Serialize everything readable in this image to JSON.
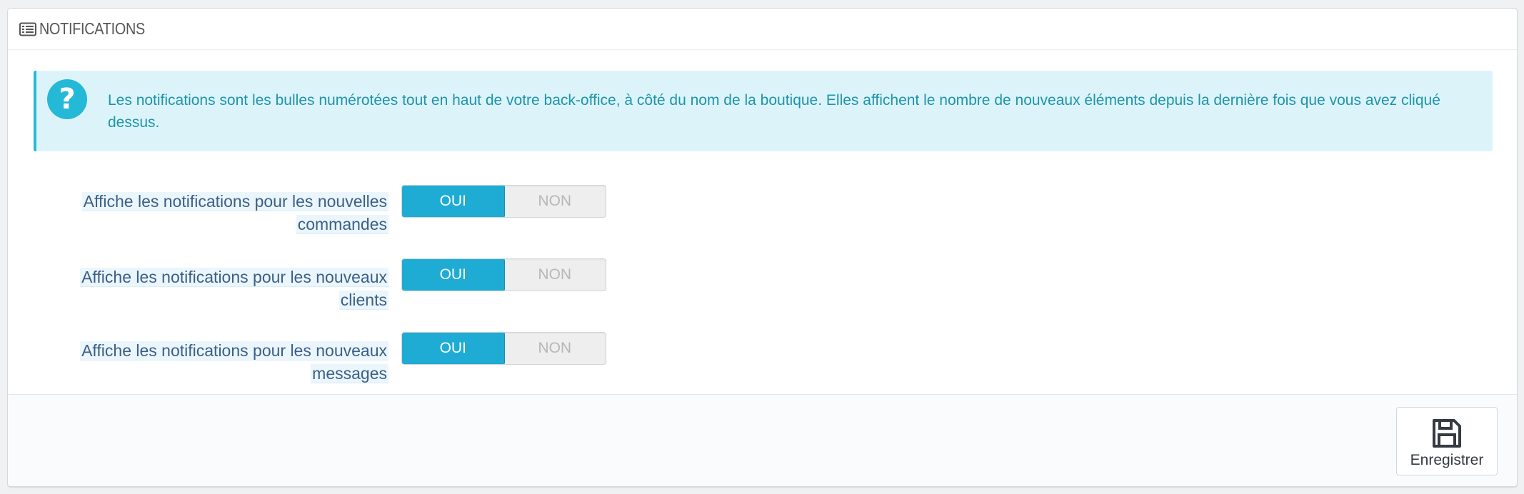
{
  "panel": {
    "title": "NOTIFICATIONS",
    "icon": "list-icon"
  },
  "alert": {
    "icon": "question-circle-icon",
    "text": "Les notifications sont les bulles numérotées tout en haut de votre back-office, à côté du nom de la boutique. Elles affichent le nombre de nouveaux éléments depuis la dernière fois que vous avez cliqué dessus."
  },
  "rows": [
    {
      "label": "Affiche les notifications pour les nouvelles commandes",
      "options": {
        "yes": "OUI",
        "no": "NON"
      },
      "selected": "OUI"
    },
    {
      "label": "Affiche les notifications pour les nouveaux clients",
      "options": {
        "yes": "OUI",
        "no": "NON"
      },
      "selected": "OUI"
    },
    {
      "label": "Affiche les notifications pour les nouveaux messages",
      "options": {
        "yes": "OUI",
        "no": "NON"
      },
      "selected": "OUI"
    }
  ],
  "footer": {
    "save_label": "Enregistrer",
    "save_icon": "floppy-disk-icon"
  },
  "colors": {
    "accent": "#25b9d7",
    "switch_active": "#1eacd4",
    "alert_bg": "#dcf4f9",
    "label_text": "#3c5f87"
  }
}
